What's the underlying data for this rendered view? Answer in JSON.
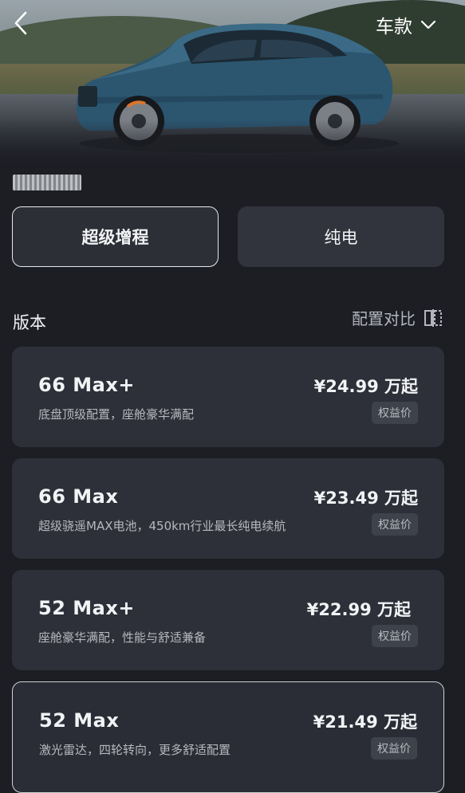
{
  "header": {
    "model_select_label": "车款"
  },
  "powertrain_tabs": [
    {
      "label": "超级增程",
      "active": true
    },
    {
      "label": "纯电",
      "active": false
    }
  ],
  "versions": {
    "title": "版本",
    "compare_label": "配置对比",
    "items": [
      {
        "name": "66 Max+",
        "desc": "底盘顶级配置，座舱豪华满配",
        "price": "¥24.99 万起",
        "badge": "权益价"
      },
      {
        "name": "66 Max",
        "desc": "超级骁遥MAX电池，450km行业最长纯电续航",
        "price": "¥23.49 万起",
        "badge": "权益价"
      },
      {
        "name": "52 Max+",
        "desc": "座舱豪华满配，性能与舒适兼备",
        "price": "¥22.99 万起",
        "badge": "权益价"
      },
      {
        "name": "52 Max",
        "desc": "激光雷达，四轮转向，更多舒适配置",
        "price": "¥21.49 万起",
        "badge": "权益价"
      }
    ]
  }
}
